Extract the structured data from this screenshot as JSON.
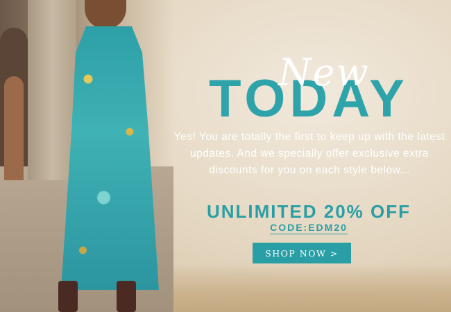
{
  "banner": {
    "script_word": "New",
    "title": "TODAY",
    "copy": "Yes! You are totally the first to keep up with the latest updates. And we specially offer exclusive extra discounts for you on each style below...",
    "offer": "UNLIMITED 20% OFF",
    "code": "CODE:EDM20",
    "button_label": "SHOP NOW >"
  },
  "colors": {
    "accent": "#2a9ea5",
    "background": "#e6d9c4",
    "text_light": "#ffffff"
  }
}
